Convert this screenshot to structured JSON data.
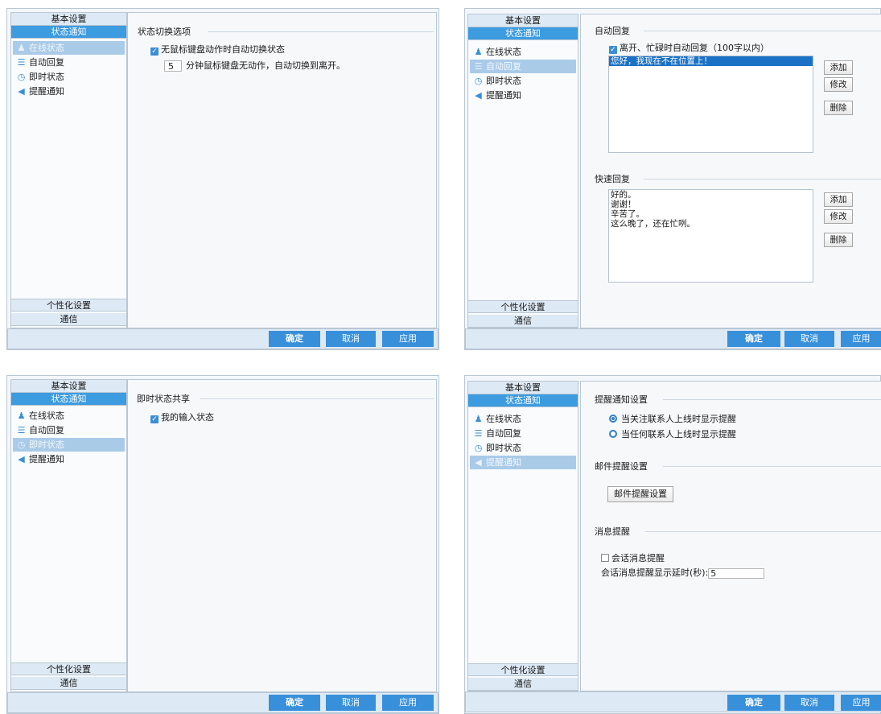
{
  "sidebar": {
    "basic_settings": "基本设置",
    "status_notify": "状态通知",
    "personalize": "个性化设置",
    "communication": "通信",
    "items": [
      {
        "label": "在线状态",
        "icon": "person-icon"
      },
      {
        "label": "自动回复",
        "icon": "chat-bubble-icon"
      },
      {
        "label": "即时状态",
        "icon": "clock-icon"
      },
      {
        "label": "提醒通知",
        "icon": "speaker-icon"
      }
    ]
  },
  "buttons": {
    "ok": "确定",
    "cancel": "取消",
    "apply": "应用"
  },
  "panel1": {
    "section_title": "状态切换选项",
    "auto_switch_label": "无鼠标键盘动作时自动切换状态",
    "minutes_value": "5",
    "minutes_suffix": "分钟鼠标键盘无动作，自动切换到离开。"
  },
  "panel2": {
    "auto_reply_title": "自动回复",
    "auto_reply_checkbox": "离开、忙碌时自动回复（100字以内）",
    "auto_reply_items": [
      "您好，我现在不在位置上！"
    ],
    "quick_reply_title": "快速回复",
    "quick_reply_items": [
      "好的。",
      "谢谢！",
      "辛苦了。",
      "这么晚了，还在忙咧。"
    ],
    "add": "添加",
    "edit": "修改",
    "delete": "删除"
  },
  "panel3": {
    "section_title": "即时状态共享",
    "input_state_label": "我的输入状态"
  },
  "panel4": {
    "notify_title": "提醒通知设置",
    "radio_focus": "当关注联系人上线时显示提醒",
    "radio_any": "当任何联系人上线时显示提醒",
    "mail_title": "邮件提醒设置",
    "mail_button": "邮件提醒设置",
    "msg_title": "消息提醒",
    "msg_checkbox": "会话消息提醒",
    "delay_label": "会话消息提醒显示延时(秒):",
    "delay_value": "5"
  },
  "colors": {
    "accent": "#3890db",
    "selected_item": "#a9cbe8",
    "panel_border": "#b9c6d3"
  }
}
